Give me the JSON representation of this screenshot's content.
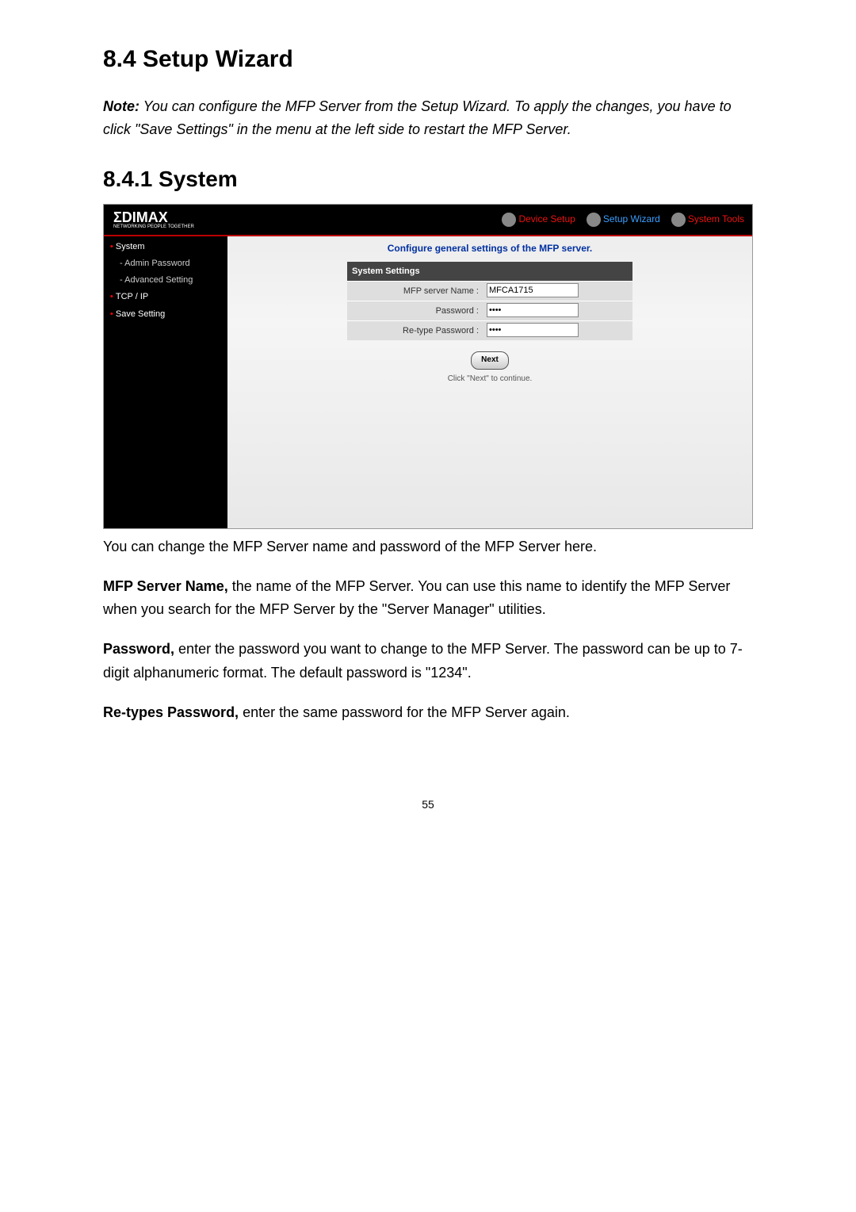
{
  "heading_main": "8.4   Setup Wizard",
  "note_prefix": "Note:",
  "note_body": " You can configure the MFP Server from the Setup Wizard. To apply the changes, you have to click \"Save Settings\" in the menu at the left side to restart the MFP Server.",
  "heading_sub": "8.4.1   System",
  "screenshot": {
    "logo_main": "ΣDIMAX",
    "logo_sub": "NETWORKING PEOPLE TOGETHER",
    "nav": {
      "device": "Device Setup",
      "wizard": "Setup Wizard",
      "tools": "System Tools"
    },
    "sidebar": {
      "system": "System",
      "admin": "- Admin Password",
      "advanced": "- Advanced Setting",
      "tcpip": "TCP / IP",
      "save": "Save Setting"
    },
    "panel_title": "Configure general settings of the MFP server.",
    "table_header": "System Settings",
    "row_name_label": "MFP server Name :",
    "row_name_value": "MFCA1715",
    "row_pwd_label": "Password :",
    "row_pwd_value": "••••",
    "row_rpwd_label": "Re-type Password :",
    "row_rpwd_value": "••••",
    "next_btn": "Next",
    "hint": "Click \"Next\" to continue."
  },
  "para1": "You can change the MFP Server name and password of the MFP Server here.",
  "para2_bold": "MFP Server Name,",
  "para2_rest": " the name of the MFP Server. You can use this name to identify the MFP Server when you search for the MFP Server by the \"Server Manager\" utilities.",
  "para3_bold": "Password,",
  "para3_rest": " enter the password you want to change to the MFP Server. The password can be up to 7-digit alphanumeric format. The default password is \"1234\".",
  "para4_bold": "Re-types Password,",
  "para4_rest": " enter the same password for the MFP Server again.",
  "page_number": "55"
}
